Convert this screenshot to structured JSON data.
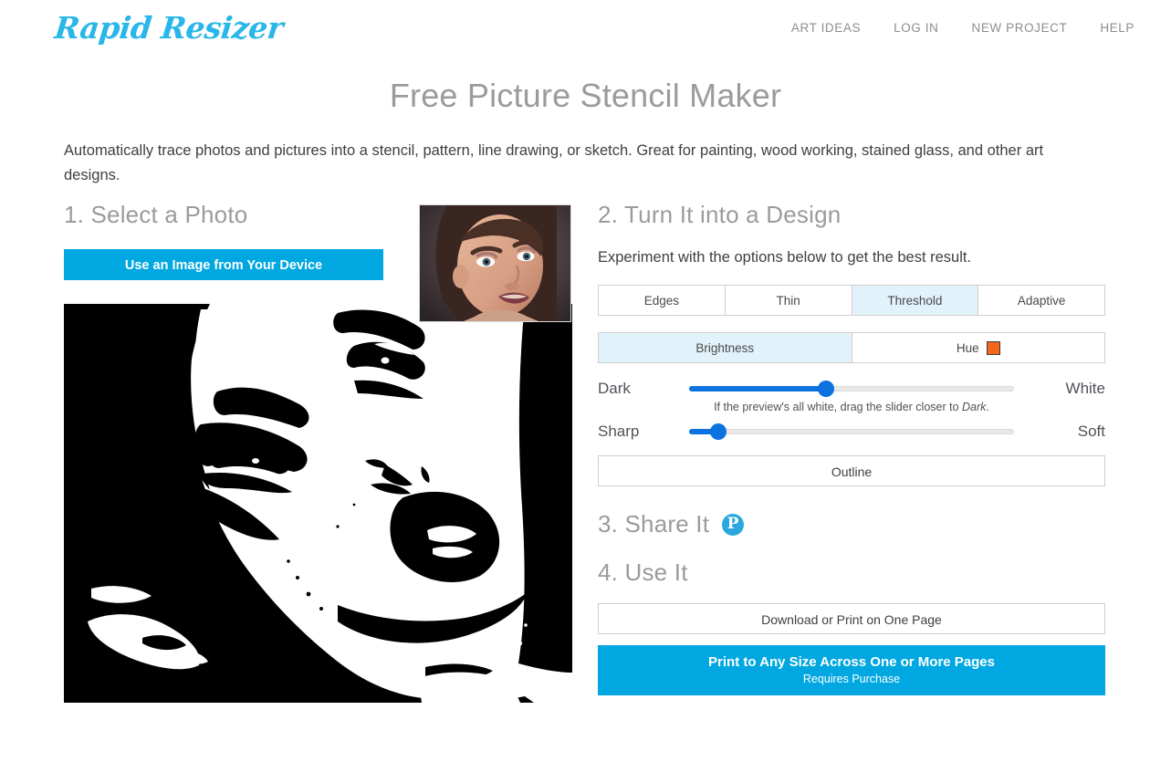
{
  "header": {
    "logo": "Rapid Resizer",
    "nav": [
      {
        "label": "ART IDEAS"
      },
      {
        "label": "LOG IN"
      },
      {
        "label": "NEW PROJECT"
      },
      {
        "label": "HELP"
      }
    ]
  },
  "page": {
    "title": "Free Picture Stencil Maker",
    "intro": "Automatically trace photos and pictures into a stencil, pattern, line drawing, or sketch. Great for painting, wood working, stained glass, and other art designs."
  },
  "step1": {
    "heading": "1. Select a Photo",
    "upload_button": "Use an Image from Your Device",
    "thumbnail_alt": "portrait-photo-thumbnail",
    "preview_alt": "black-and-white-stencil-preview"
  },
  "step2": {
    "heading": "2. Turn It into a Design",
    "subtitle": "Experiment with the options below to get the best result.",
    "mode_tabs": [
      {
        "label": "Edges",
        "active": false
      },
      {
        "label": "Thin",
        "active": false
      },
      {
        "label": "Threshold",
        "active": true
      },
      {
        "label": "Adaptive",
        "active": false
      }
    ],
    "channel_tabs": [
      {
        "label": "Brightness",
        "active": true,
        "swatch": null
      },
      {
        "label": "Hue",
        "active": false,
        "swatch": "#f4661b"
      }
    ],
    "slider_brightness": {
      "left_label": "Dark",
      "right_label": "White",
      "value_percent": 42,
      "hint_before": "If the preview's all white, drag the slider closer to ",
      "hint_emphasis": "Dark",
      "hint_after": "."
    },
    "slider_sharpness": {
      "left_label": "Sharp",
      "right_label": "Soft",
      "value_percent": 9
    },
    "outline_button": "Outline"
  },
  "step3": {
    "heading": "3. Share It",
    "pinterest_glyph": "P"
  },
  "step4": {
    "heading": "4. Use It",
    "download_button": "Download or Print on One Page",
    "cta_main": "Print to Any Size Across One or More Pages",
    "cta_sub": "Requires Purchase"
  },
  "colors": {
    "brand_cyan": "#00a7e1",
    "logo_cyan": "#29b6e8",
    "active_tab": "#e2f2fa",
    "slider_blue": "#0b72e0",
    "hue_swatch": "#f4661b",
    "pinterest_blue": "#2aa8dd"
  }
}
